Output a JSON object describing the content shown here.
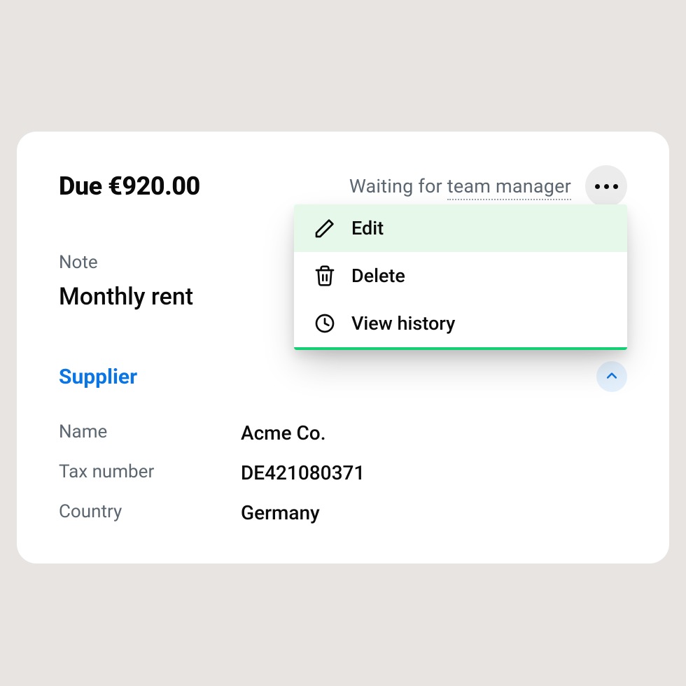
{
  "header": {
    "due_label": "Due €920.00",
    "status_prefix": "Waiting for ",
    "status_role": "team manager"
  },
  "note": {
    "label": "Note",
    "value": "Monthly rent"
  },
  "supplier": {
    "title": "Supplier",
    "fields": {
      "name_label": "Name",
      "name_value": "Acme Co.",
      "tax_label": "Tax number",
      "tax_value": "DE421080371",
      "country_label": "Country",
      "country_value": "Germany"
    }
  },
  "menu": {
    "edit": "Edit",
    "delete": "Delete",
    "view_history": "View history"
  }
}
